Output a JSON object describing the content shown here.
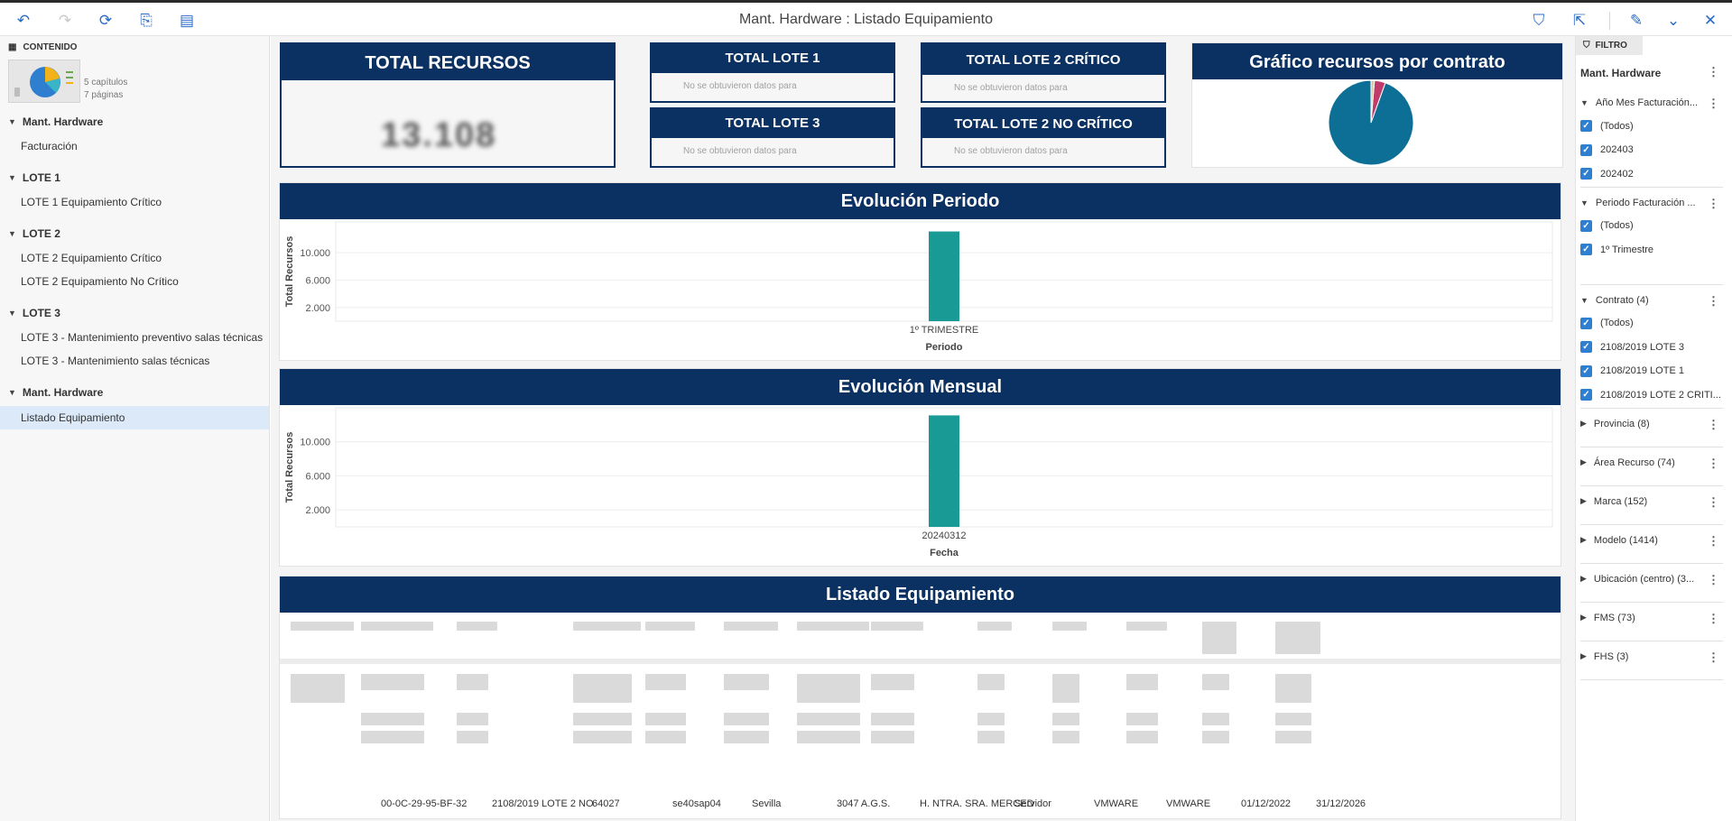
{
  "window": {
    "title": "Mant. Hardware : Listado Equipamiento"
  },
  "toolbar_left": [
    {
      "name": "undo-icon",
      "glyph": "↶",
      "enabled": true
    },
    {
      "name": "redo-icon",
      "glyph": "↷",
      "enabled": false
    },
    {
      "name": "refresh-icon",
      "glyph": "⟳",
      "enabled": true
    },
    {
      "name": "export-document-icon",
      "glyph": "⎘",
      "enabled": true
    },
    {
      "name": "list-view-icon",
      "glyph": "▤",
      "enabled": true
    }
  ],
  "toolbar_right": [
    {
      "name": "filter-icon",
      "glyph": "⛉"
    },
    {
      "name": "share-icon",
      "glyph": "⇱"
    },
    {
      "name": "edit-pencil-icon",
      "glyph": "✎"
    },
    {
      "name": "collapse-chevron-icon",
      "glyph": "⌄"
    },
    {
      "name": "close-icon",
      "glyph": "✕"
    }
  ],
  "sidebar": {
    "header": "CONTENIDO",
    "thumb_meta": [
      "5 capítulos",
      "7 páginas"
    ],
    "sections": [
      {
        "title": "Mant. Hardware",
        "items": [
          "Facturación"
        ]
      },
      {
        "title": "LOTE 1",
        "items": [
          "LOTE 1 Equipamiento Crítico"
        ]
      },
      {
        "title": "LOTE 2",
        "items": [
          "LOTE 2 Equipamiento Crítico",
          "LOTE 2 Equipamiento No Crítico"
        ]
      },
      {
        "title": "LOTE 3",
        "items": [
          "LOTE 3 - Mantenimiento preventivo salas técnicas",
          "LOTE 3 - Mantenimiento salas técnicas"
        ]
      },
      {
        "title": "Mant. Hardware",
        "items": [
          "Listado Equipamiento"
        ]
      }
    ],
    "active_item": "Listado Equipamiento"
  },
  "kpis": {
    "total_recursos": {
      "title": "TOTAL RECURSOS",
      "value": "13.108"
    },
    "lote1": {
      "title": "TOTAL LOTE 1",
      "message": "No se obtuvieron datos para"
    },
    "lote3": {
      "title": "TOTAL LOTE 3",
      "message": "No se obtuvieron datos para"
    },
    "lote2_critico": {
      "title": "TOTAL LOTE 2 CRÍTICO",
      "message": "No se obtuvieron datos para"
    },
    "lote2_no_critico": {
      "title": "TOTAL LOTE 2 NO CRÍTICO",
      "message": "No se obtuvieron datos para"
    }
  },
  "pie": {
    "title": "Gráfico recursos por contrato"
  },
  "colors": {
    "navy": "#0a3161",
    "teal": "#1a9a95",
    "pie_main": "#0e6f96",
    "pie_accent": "#c03b6a",
    "link_blue": "#2a6cc9",
    "checkbox": "#2f7fd1"
  },
  "chart_data": [
    {
      "type": "bar",
      "title": "Evolución Periodo",
      "xlabel": "Periodo",
      "ylabel": "Total Recursos",
      "categories": [
        "1º TRIMESTRE"
      ],
      "values": [
        13108
      ],
      "ylim": [
        0,
        14500
      ],
      "yticks": [
        2000,
        6000,
        10000
      ],
      "ytick_labels": [
        "2.000",
        "6.000",
        "10.000"
      ],
      "grid": true
    },
    {
      "type": "bar",
      "title": "Evolución Mensual",
      "xlabel": "Fecha",
      "ylabel": "Total Recursos",
      "categories": [
        "20240312"
      ],
      "values": [
        13108
      ],
      "ylim": [
        0,
        14000
      ],
      "yticks": [
        2000,
        6000,
        10000
      ],
      "ytick_labels": [
        "2.000",
        "6.000",
        "10.000"
      ],
      "grid": true
    },
    {
      "type": "pie",
      "title": "Gráfico recursos por contrato",
      "slices": [
        {
          "value": 94.5,
          "color": "#0e6f96"
        },
        {
          "value": 4.2,
          "color": "#c03b6a"
        },
        {
          "value": 1.3,
          "color": "#d9c9a0"
        }
      ]
    }
  ],
  "table": {
    "title": "Listado Equipamiento",
    "visible_row": [
      "00-0C-29-95-BF-32",
      "2108/2019 LOTE 2 NO",
      "64027",
      "se40sap04",
      "Sevilla",
      "3047 A.G.S.",
      "H. NTRA. SRA. MERCED",
      "Servidor",
      "VMWARE",
      "VMWARE",
      "01/12/2022",
      "31/12/2026"
    ]
  },
  "filter": {
    "tab": "FILTRO",
    "title": "Mant. Hardware",
    "groups": [
      {
        "label": "Año Mes Facturación...",
        "expanded": true,
        "options": [
          "(Todos)",
          "202403",
          "202402"
        ]
      },
      {
        "label": "Periodo Facturación ...",
        "expanded": true,
        "options": [
          "(Todos)",
          "1º Trimestre"
        ]
      },
      {
        "label": "Contrato (4)",
        "expanded": true,
        "options": [
          "(Todos)",
          "2108/2019 LOTE 3",
          "2108/2019 LOTE 1",
          "2108/2019 LOTE 2 CRITI..."
        ]
      },
      {
        "label": "Provincia (8)",
        "expanded": false
      },
      {
        "label": "Área Recurso (74)",
        "expanded": false
      },
      {
        "label": "Marca (152)",
        "expanded": false
      },
      {
        "label": "Modelo (1414)",
        "expanded": false
      },
      {
        "label": "Ubicación (centro) (3...",
        "expanded": false
      },
      {
        "label": "FMS (73)",
        "expanded": false
      },
      {
        "label": "FHS (3)",
        "expanded": false
      }
    ]
  }
}
